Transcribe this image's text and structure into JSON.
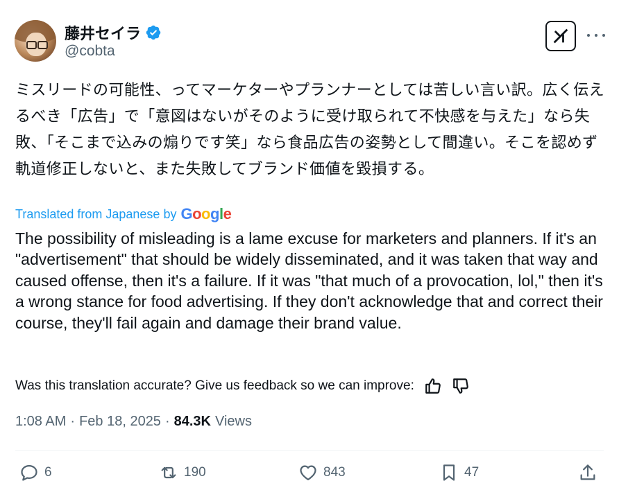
{
  "author": {
    "display_name": "藤井セイラ",
    "handle": "@cobta",
    "verified": true
  },
  "tweet": {
    "text": "ミスリードの可能性、ってマーケターやプランナーとしては苦しい言い訳。広く伝えるべき「広告」で「意図はないがそのように受け取られて不快感を与えた」なら失敗、「そこまで込みの煽りです笑」なら食品広告の姿勢として間違い。そこを認めず軌道修正しないと、また失敗してブランド価値を毀損する。",
    "translated_label": "Translated from Japanese by",
    "translator_logo": "Google",
    "translation": "The possibility of misleading is a lame excuse for marketers and planners. If it's an \"advertisement\" that should be widely disseminated, and it was taken that way and caused offense, then it's a failure. If it was \"that much of a provocation, lol,\" then it's a wrong stance for food advertising. If they don't acknowledge that and correct their course, they'll fail again and damage their brand value.",
    "feedback_prompt": "Was this translation accurate? Give us feedback so we can improve:"
  },
  "meta": {
    "time": "1:08 AM",
    "separator": "·",
    "date": "Feb 18, 2025",
    "views_count": "84.3K",
    "views_label": "Views"
  },
  "actions": {
    "replies": "6",
    "reposts": "190",
    "likes": "843",
    "bookmarks": "47"
  },
  "colors": {
    "accent": "#1d9bf0",
    "text": "#0f1419",
    "muted": "#536471"
  },
  "icons": [
    "verified-badge-icon",
    "grok-icon",
    "more-icon",
    "thumbs-up-icon",
    "thumbs-down-icon",
    "reply-icon",
    "repost-icon",
    "like-icon",
    "bookmark-icon",
    "share-icon"
  ]
}
